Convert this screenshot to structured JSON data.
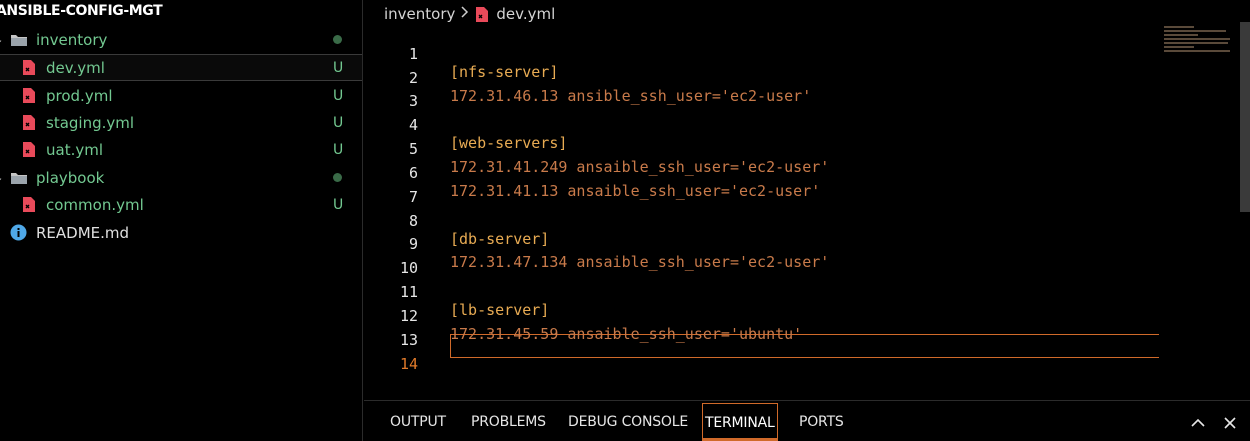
{
  "explorer": {
    "title": "ANSIBLE-CONFIG-MGT",
    "items": [
      {
        "label": "inventory",
        "type": "folder",
        "status": "dot"
      },
      {
        "label": "dev.yml",
        "type": "file",
        "status": "U"
      },
      {
        "label": "prod.yml",
        "type": "file",
        "status": "U"
      },
      {
        "label": "staging.yml",
        "type": "file",
        "status": "U"
      },
      {
        "label": "uat.yml",
        "type": "file",
        "status": "U"
      },
      {
        "label": "playbook",
        "type": "folder",
        "status": "dot"
      },
      {
        "label": "common.yml",
        "type": "file",
        "status": "U"
      },
      {
        "label": "README.md",
        "type": "info",
        "status": ""
      }
    ]
  },
  "breadcrumb": {
    "folder": "inventory",
    "file": "dev.yml"
  },
  "editor": {
    "lines": [
      {
        "n": "1",
        "text": "[nfs-server]"
      },
      {
        "n": "2",
        "text": "172.31.46.13 ansible_ssh_user='ec2-user'"
      },
      {
        "n": "3",
        "text": ""
      },
      {
        "n": "4",
        "text": "[web-servers]"
      },
      {
        "n": "5",
        "text": "172.31.41.249 ansaible_ssh_user='ec2-user'"
      },
      {
        "n": "6",
        "text": "172.31.41.13 ansaible_ssh_user='ec2-user'"
      },
      {
        "n": "7",
        "text": ""
      },
      {
        "n": "8",
        "text": "[db-server]"
      },
      {
        "n": "9",
        "text": "172.31.47.134 ansaible_ssh_user='ec2-user'"
      },
      {
        "n": "10",
        "text": ""
      },
      {
        "n": "11",
        "text": "[lb-server]"
      },
      {
        "n": "12",
        "text": "172.31.45.59 ansaible_ssh_user='ubuntu'"
      },
      {
        "n": "13",
        "text": ""
      },
      {
        "n": "14",
        "text": ""
      }
    ],
    "current_line": "14"
  },
  "panel": {
    "tabs": [
      "OUTPUT",
      "PROBLEMS",
      "DEBUG CONSOLE",
      "TERMINAL",
      "PORTS"
    ],
    "active_tab": "TERMINAL"
  },
  "colors": {
    "accent": "#d06a2a",
    "untracked": "#73c991",
    "section": "#e8ab53",
    "yaml_file": "#e94a5a"
  },
  "icons": [
    "chevron-down-icon",
    "folder-icon",
    "yaml-file-icon",
    "info-icon",
    "chevron-right-icon",
    "chevron-up-icon",
    "close-icon"
  ]
}
